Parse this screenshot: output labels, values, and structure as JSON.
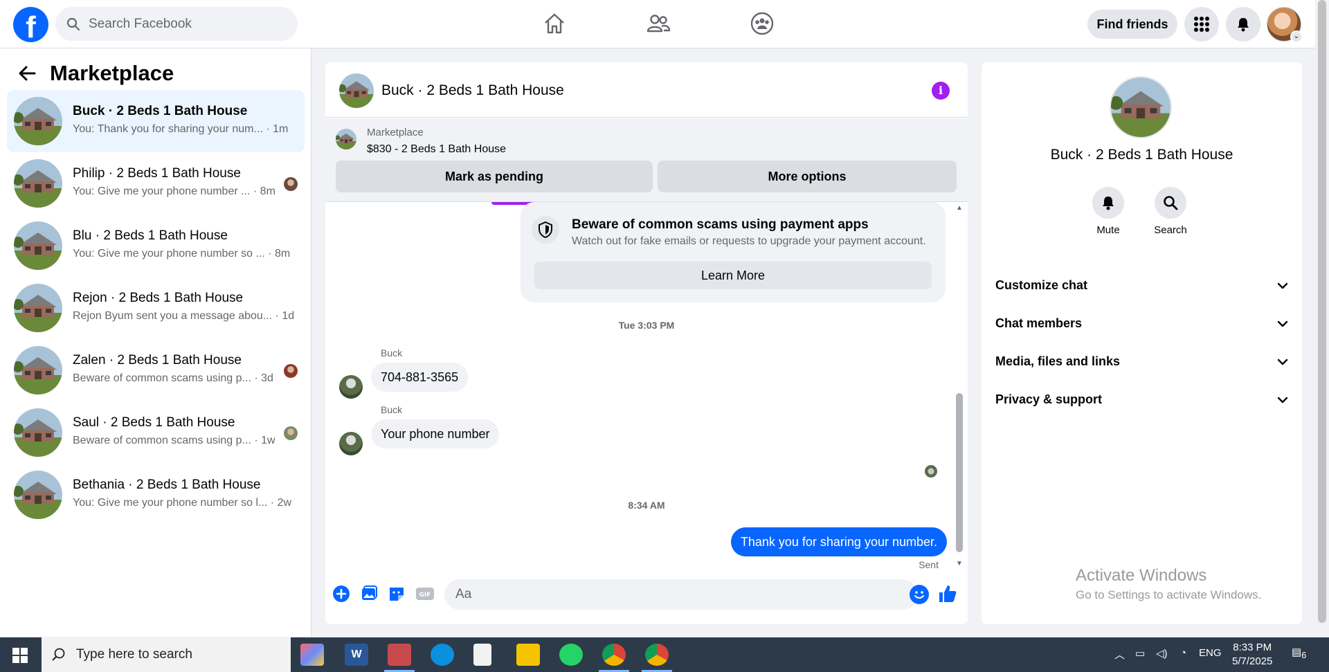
{
  "topbar": {
    "search_placeholder": "Search Facebook",
    "find_friends": "Find friends"
  },
  "left": {
    "title": "Marketplace",
    "conversations": [
      {
        "name": "Buck · 2 Beds 1 Bath House",
        "preview": "You: Thank you for sharing your num... · 1m",
        "active": true
      },
      {
        "name": "Philip · 2 Beds 1 Bath House",
        "preview": "You: Give me your phone number ... · 8m"
      },
      {
        "name": "Blu · 2 Beds 1 Bath House",
        "preview": "You: Give me your phone number so ... · 8m"
      },
      {
        "name": "Rejon · 2 Beds 1 Bath House",
        "preview": "Rejon Byum sent you a message abou... · 1d"
      },
      {
        "name": "Zalen · 2 Beds 1 Bath House",
        "preview": "Beware of common scams using p... · 3d"
      },
      {
        "name": "Saul · 2 Beds 1 Bath House",
        "preview": "Beware of common scams using p... · 1w"
      },
      {
        "name": "Bethania · 2 Beds 1 Bath House",
        "preview": "You: Give me your phone number so l... · 2w"
      }
    ]
  },
  "chat": {
    "title": "Buck · 2 Beds 1 Bath House",
    "marketplace_label": "Marketplace",
    "listing": "$830 - 2 Beds 1 Bath House",
    "mark_pending": "Mark as pending",
    "more_options": "More options",
    "scam_title": "Beware of common scams using payment apps",
    "scam_sub": "Watch out for fake emails or requests to upgrade your payment account.",
    "learn_more": "Learn More",
    "ts1": "Tue 3:03 PM",
    "sender1": "Buck",
    "msg1": "704-881-3565",
    "sender2": "Buck",
    "msg2": "Your phone number",
    "ts2": "8:34 AM",
    "msg_out": "Thank you for sharing your number.",
    "sent": "Sent",
    "composer_placeholder": "Aa",
    "gif": "GIF"
  },
  "right": {
    "name": "Buck · 2 Beds 1 Bath House",
    "mute": "Mute",
    "search": "Search",
    "rows": [
      "Customize chat",
      "Chat members",
      "Media, files and links",
      "Privacy & support"
    ],
    "activate1": "Activate Windows",
    "activate2": "Go to Settings to activate Windows."
  },
  "taskbar": {
    "search_placeholder": "Type here to search",
    "lang": "ENG",
    "time": "8:33 PM",
    "date": "5/7/2025",
    "notif_count": "6"
  },
  "colors": {
    "brand": "#0866ff",
    "accent_purple": "#a020f0"
  }
}
